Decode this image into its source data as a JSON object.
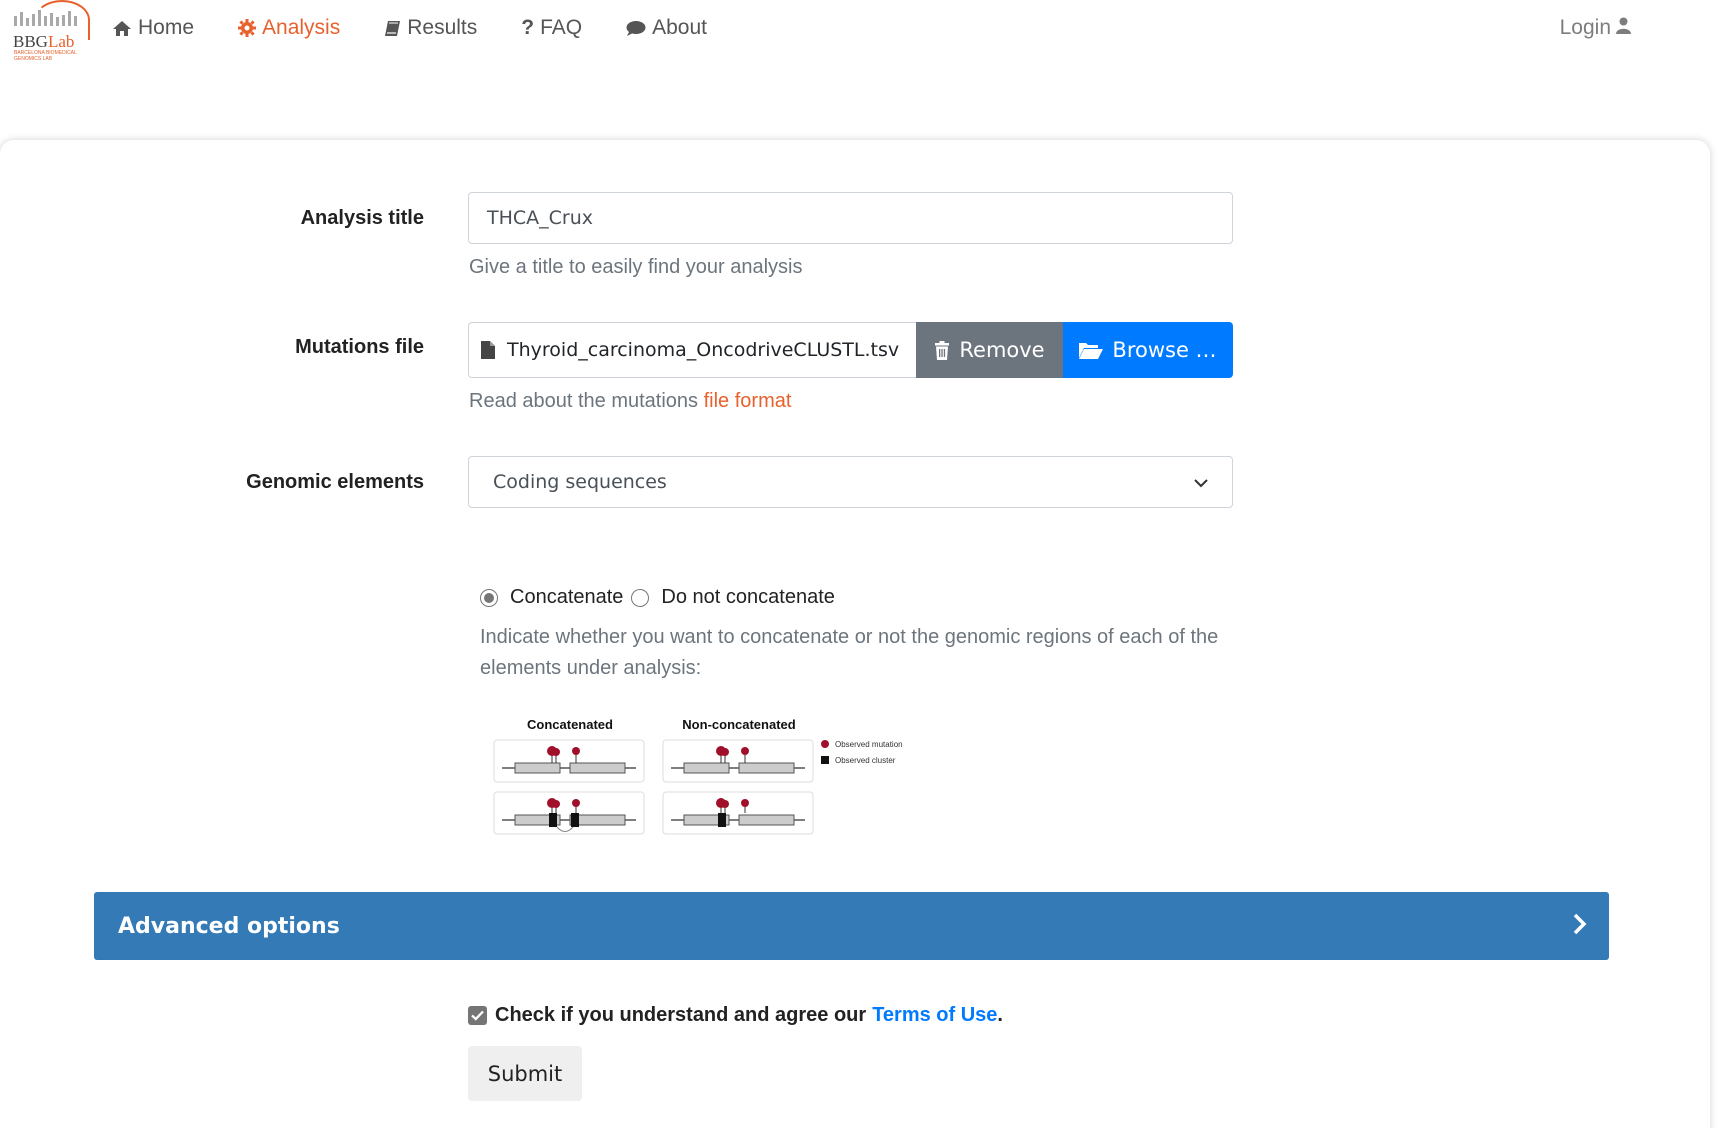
{
  "nav": {
    "logo_text_1": "BBG",
    "logo_text_2": "Lab",
    "logo_sub": "BARCELONA BIOMEDICAL GENOMICS LAB",
    "items": [
      {
        "label": "Home",
        "icon": "home-icon",
        "active": false
      },
      {
        "label": "Analysis",
        "icon": "gear-icon",
        "active": true
      },
      {
        "label": "Results",
        "icon": "book-icon",
        "active": false
      },
      {
        "label": "FAQ",
        "icon": "question-icon",
        "active": false
      },
      {
        "label": "About",
        "icon": "comment-icon",
        "active": false
      }
    ],
    "login": "Login",
    "login_icon": "user-icon"
  },
  "form": {
    "title_label": "Analysis title",
    "title_value": "THCA_Crux",
    "title_help": "Give a title to easily find your analysis",
    "mutations_label": "Mutations file",
    "mutations_file": "Thyroid_carcinoma_OncodriveCLUSTL.tsv",
    "remove_label": "Remove",
    "browse_label": "Browse …",
    "mutations_help": "Read about the mutations",
    "mutations_help_link": "file format",
    "genomic_label": "Genomic elements",
    "genomic_value": "Coding sequences",
    "radio_concat": "Concatenate",
    "radio_noconcat": "Do not concatenate",
    "radio_selected": "Concatenate",
    "concat_help": "Indicate whether you want to concatenate or not the genomic regions of each of the elements under analysis:",
    "diagram": {
      "title_left": "Concatenated",
      "title_right": "Non-concatenated",
      "legend_mutation": "Observed mutation",
      "legend_cluster": "Observed cluster"
    }
  },
  "advanced": {
    "title": "Advanced options"
  },
  "terms": {
    "text": "Check if you understand and agree our",
    "link": "Terms of Use",
    "end": ".",
    "checked": true
  },
  "submit": {
    "label": "Submit"
  },
  "colors": {
    "accent": "#e8612c",
    "primary": "#007bff",
    "panel": "#337ab7",
    "secondary": "#6c757d"
  }
}
